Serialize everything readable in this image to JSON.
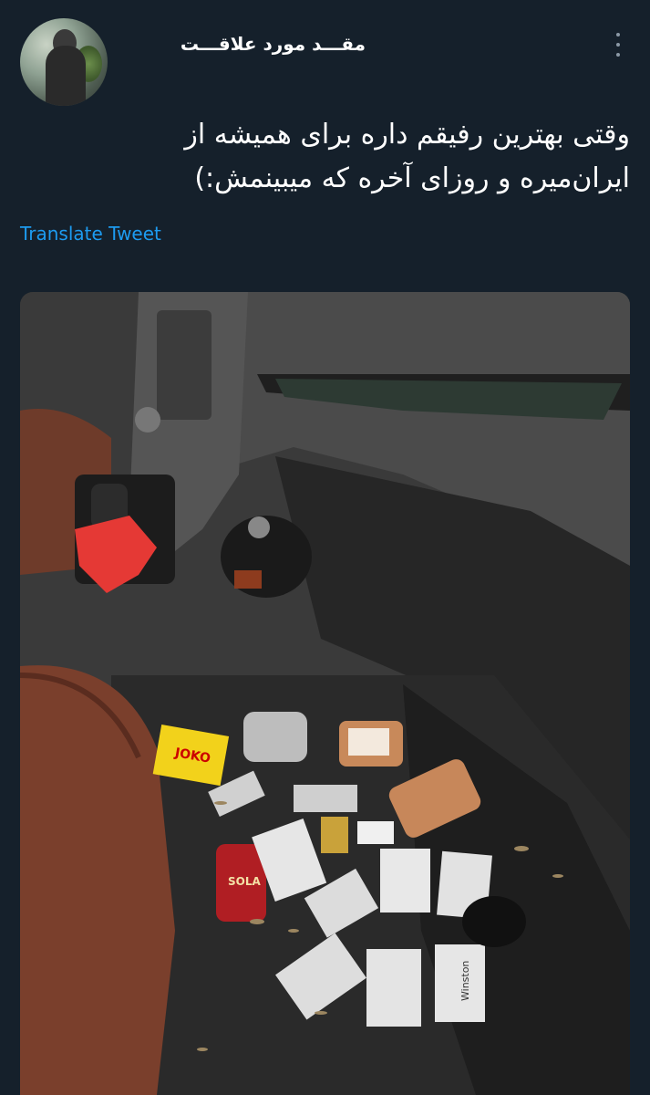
{
  "user": {
    "display_name": "مقـــد مورد علاقـــت",
    "avatar_icon": "profile-photo",
    "more_icon": "more-vertical-icon"
  },
  "tweet": {
    "text_line1": "وقتی بهترین رفیقم داره برای همیشه از",
    "text_line2": "ایران‌میره و روزای آخره که میبینمش:)",
    "translate_label": "Translate Tweet"
  },
  "photo": {
    "description_icon": "attached-photo",
    "labels": {
      "winston": "Winston",
      "sola": "SOLA",
      "joko": "JOKO"
    }
  },
  "colors": {
    "background": "#15202b",
    "text": "#ffffff",
    "link": "#1d9bf0",
    "muted": "#8b98a5"
  }
}
